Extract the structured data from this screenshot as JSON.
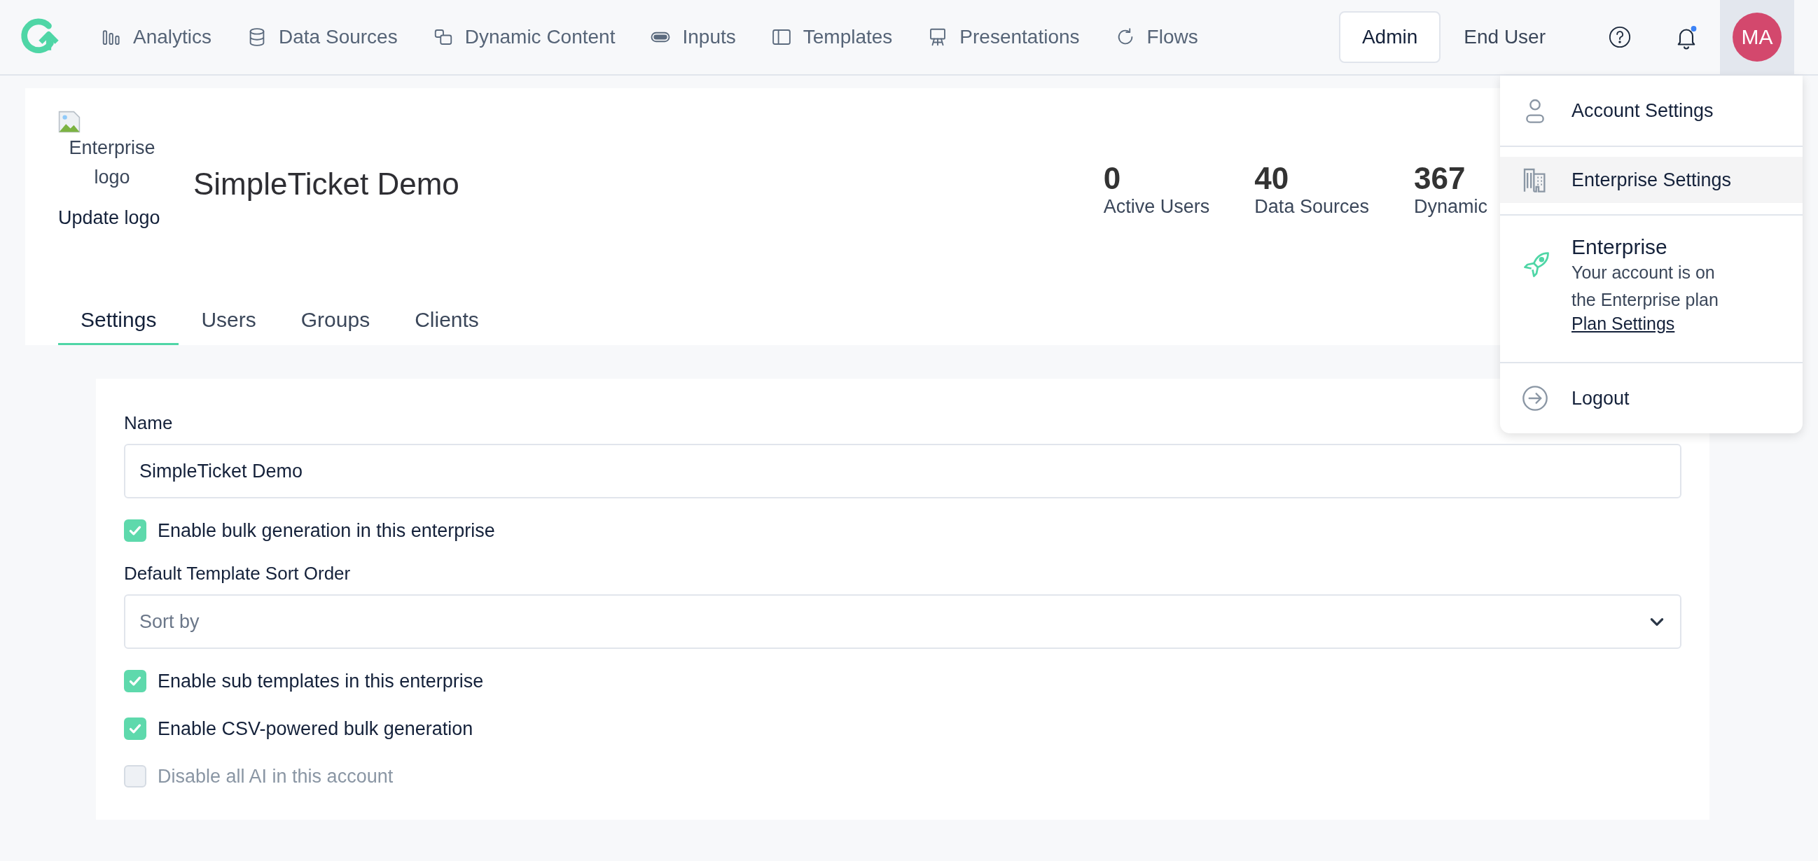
{
  "nav": {
    "items": [
      {
        "label": "Analytics"
      },
      {
        "label": "Data Sources"
      },
      {
        "label": "Dynamic Content"
      },
      {
        "label": "Inputs"
      },
      {
        "label": "Templates"
      },
      {
        "label": "Presentations"
      },
      {
        "label": "Flows"
      }
    ],
    "modes": [
      {
        "label": "Admin",
        "selected": true
      },
      {
        "label": "End User",
        "selected": false
      }
    ],
    "notification_unread": true,
    "avatar": "MA"
  },
  "header": {
    "logo_alt": "Enterprise logo",
    "update_logo": "Update logo",
    "name": "SimpleTicket Demo",
    "stats": [
      {
        "value": "0",
        "label": "Active Users"
      },
      {
        "value": "40",
        "label": "Data Sources"
      },
      {
        "value": "367",
        "label": "Dynamic"
      }
    ],
    "tabs": [
      {
        "label": "Settings",
        "selected": true
      },
      {
        "label": "Users",
        "selected": false
      },
      {
        "label": "Groups",
        "selected": false
      },
      {
        "label": "Clients",
        "selected": false
      }
    ]
  },
  "form": {
    "fields": [
      {
        "kind": "text",
        "label": "Name",
        "value": "SimpleTicket Demo"
      },
      {
        "kind": "checkbox",
        "label": "Enable bulk generation in this enterprise",
        "checked": true,
        "disabled": false
      },
      {
        "kind": "select",
        "label": "Default Template Sort Order",
        "placeholder": "Sort by"
      },
      {
        "kind": "checkbox",
        "label": "Enable sub templates in this enterprise",
        "checked": true,
        "disabled": false
      },
      {
        "kind": "checkbox",
        "label": "Enable CSV-powered bulk generation",
        "checked": true,
        "disabled": false
      },
      {
        "kind": "checkbox",
        "label": "Disable all AI in this account",
        "checked": false,
        "disabled": true
      }
    ]
  },
  "account_menu": {
    "items": [
      {
        "kind": "link",
        "label": "Account Settings",
        "selected": false
      },
      {
        "kind": "link",
        "label": "Enterprise Settings",
        "selected": true
      },
      {
        "kind": "plan",
        "title": "Enterprise",
        "text": "Your account is on the Enterprise plan",
        "link": "Plan Settings"
      },
      {
        "kind": "link",
        "label": "Logout",
        "selected": false
      }
    ]
  }
}
